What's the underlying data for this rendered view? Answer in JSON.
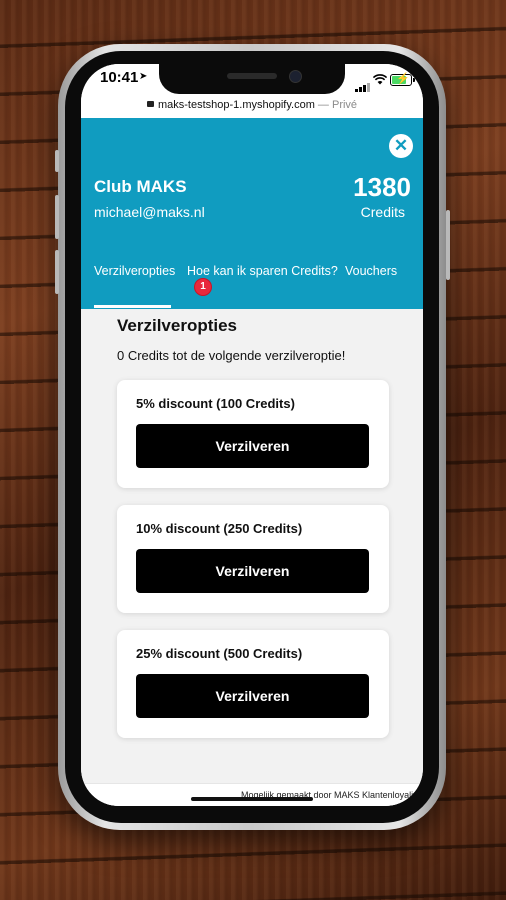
{
  "status_bar": {
    "time": "10:41"
  },
  "browser": {
    "url": "maks-testshop-1.myshopify.com",
    "separator": " — ",
    "mode": "Privé"
  },
  "header": {
    "club_name": "Club MAKS",
    "email": "michael@maks.nl",
    "credits_value": "1380",
    "credits_label": "Credits",
    "close_symbol": "✕"
  },
  "tabs": [
    {
      "label": "Verzilveropties",
      "active": true
    },
    {
      "label": "Hoe kan ik sparen Credits?",
      "badge": "1"
    },
    {
      "label": "Vouchers"
    }
  ],
  "main": {
    "title": "Verzilveropties",
    "subtitle": "0 Credits tot de volgende verzilveroptie!",
    "options": [
      {
        "title": "5% discount (100 Credits)",
        "button": "Verzilveren"
      },
      {
        "title": "10% discount (250 Credits)",
        "button": "Verzilveren"
      },
      {
        "title": "25% discount (500 Credits)",
        "button": "Verzilveren"
      }
    ]
  },
  "footer": {
    "text": "Mogelijk gemaakt door MAKS Klantenloyaliteit"
  },
  "colors": {
    "brand": "#109cc0",
    "badge": "#e8283c",
    "button": "#000000"
  }
}
